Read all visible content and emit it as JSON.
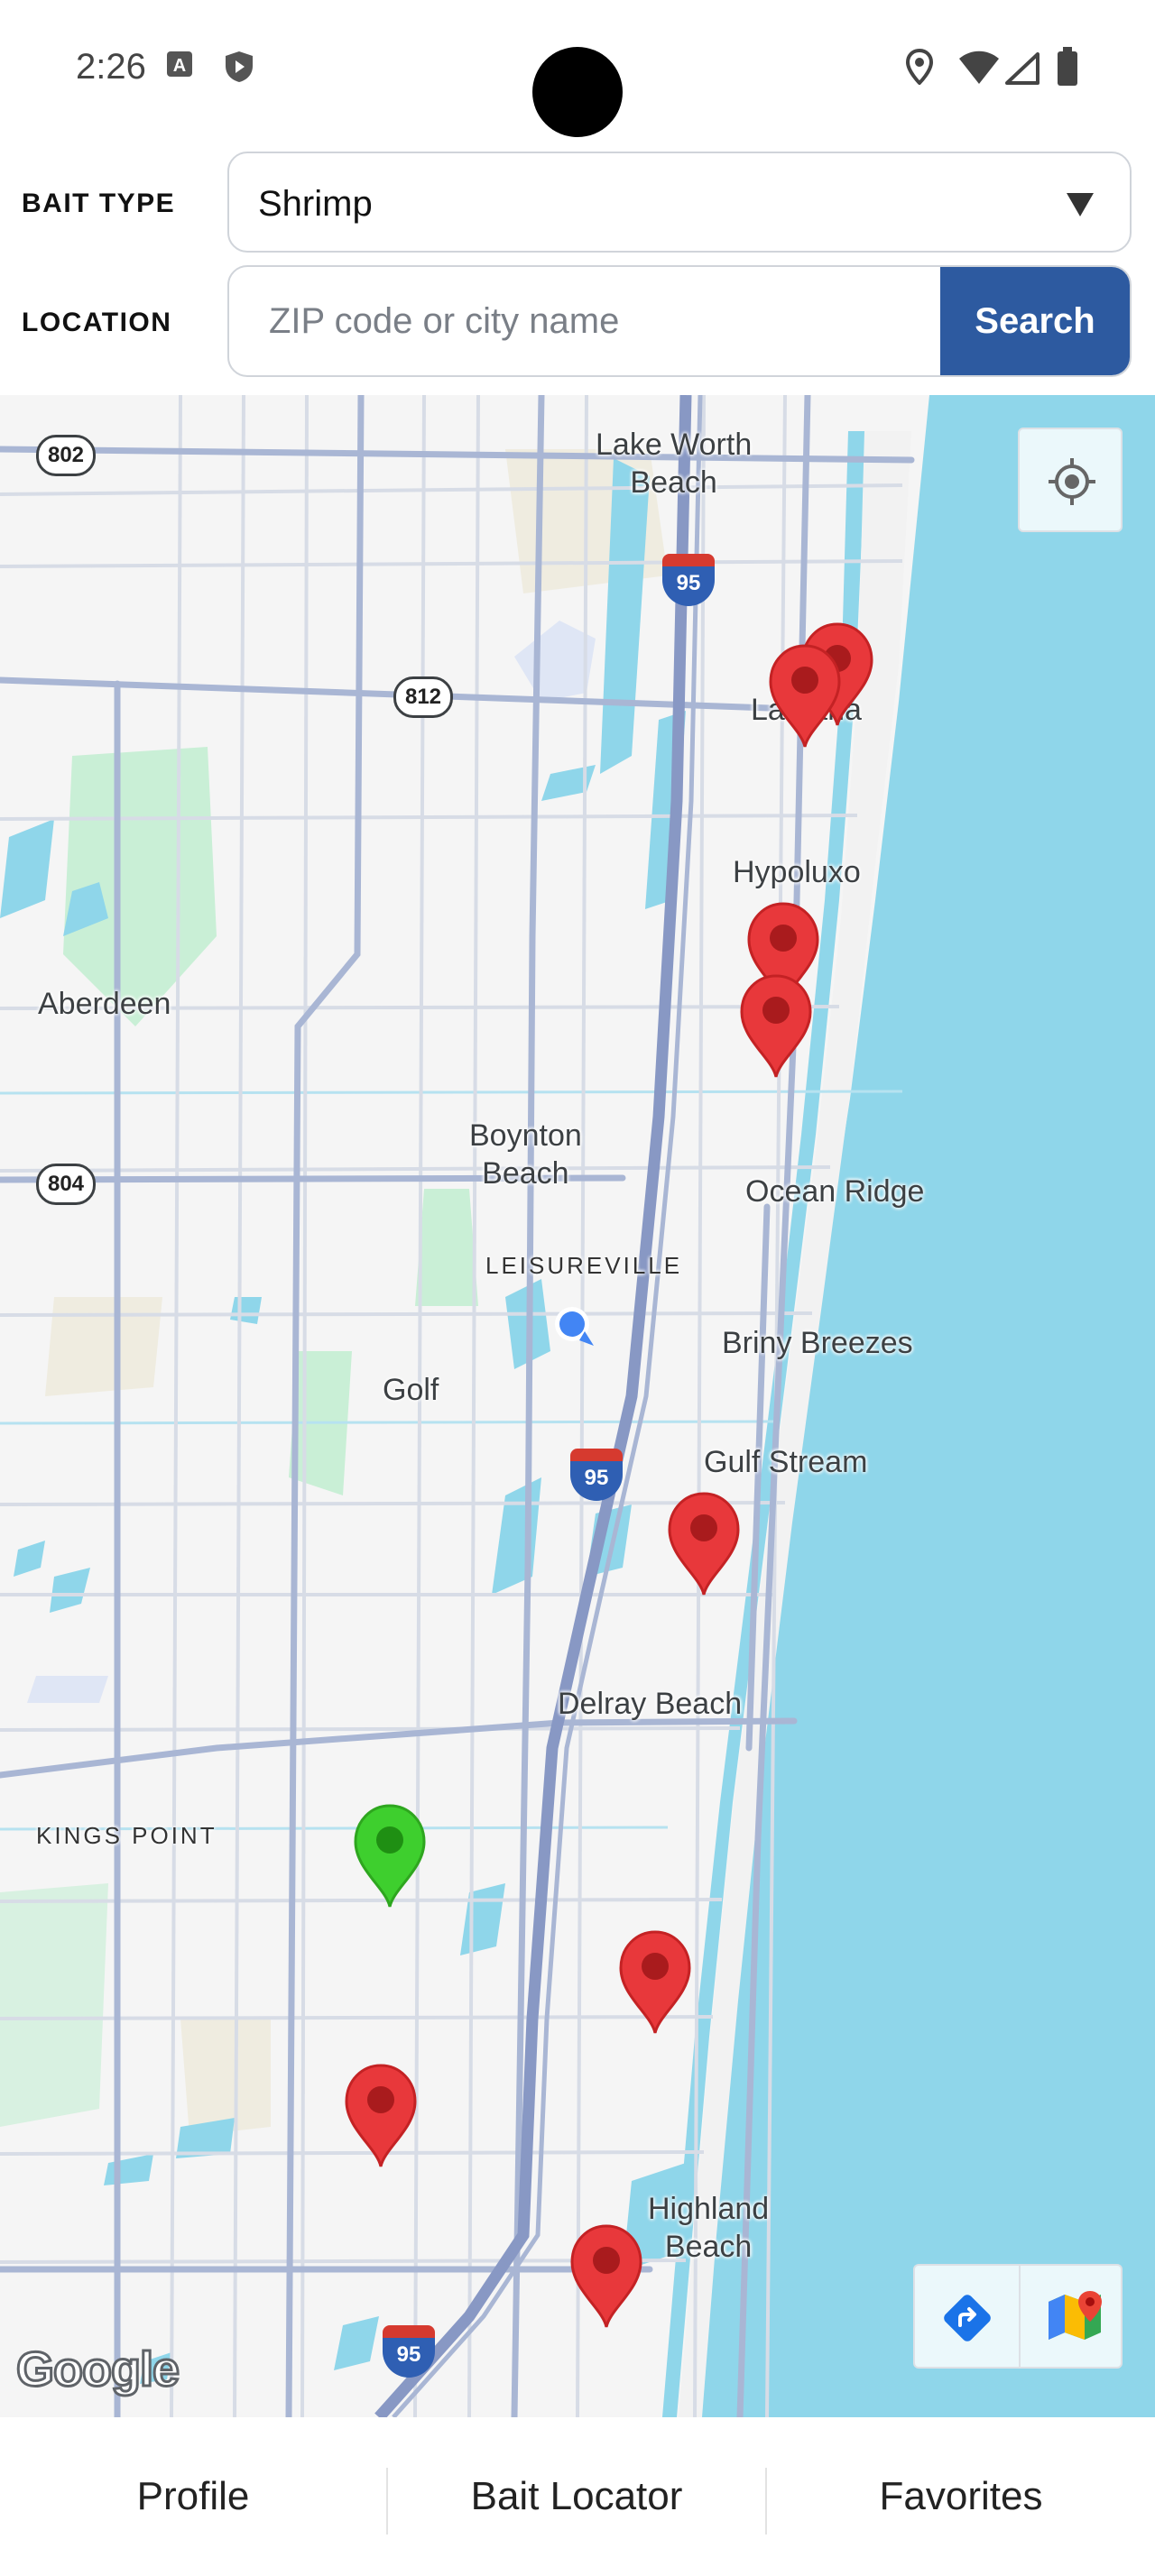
{
  "status_bar": {
    "time": "2:26",
    "icons": [
      "a-badge-icon",
      "shield-icon",
      "location-icon",
      "wifi-icon",
      "signal-icon",
      "battery-icon"
    ]
  },
  "form": {
    "bait_type_label": "BAIT TYPE",
    "bait_type_value": "Shrimp",
    "location_label": "LOCATION",
    "location_placeholder": "ZIP code or city name",
    "location_value": "",
    "search_label": "Search"
  },
  "map": {
    "places": {
      "lake_worth": "Lake Worth\nBeach",
      "lantana": "Lantana",
      "hypoluxo": "Hypoluxo",
      "aberdeen": "Aberdeen",
      "boynton": "Boynton\nBeach",
      "ocean_ridge": "Ocean Ridge",
      "leisureville": "LEISUREVILLE",
      "briny": "Briny Breezes",
      "golf": "Golf",
      "gulf_stream": "Gulf Stream",
      "delray": "Delray Beach",
      "kings_point": "KINGS POINT",
      "highland": "Highland\nBeach"
    },
    "route_shields": [
      "802",
      "812",
      "804"
    ],
    "interstate_shields": [
      "95",
      "95",
      "95"
    ],
    "markers": {
      "bait_shops": 10,
      "selected": 1,
      "user_location": 1
    },
    "attribution": "Google",
    "colors": {
      "water": "#8fd6ea",
      "land": "#f5f5f5",
      "park": "#c9efd6",
      "road": "#a9b6d4",
      "marker_red": "#e8383b",
      "marker_green": "#3ecf2e",
      "user_dot": "#4285f4"
    }
  },
  "nav": {
    "tabs": [
      "Profile",
      "Bait Locator",
      "Favorites"
    ]
  }
}
